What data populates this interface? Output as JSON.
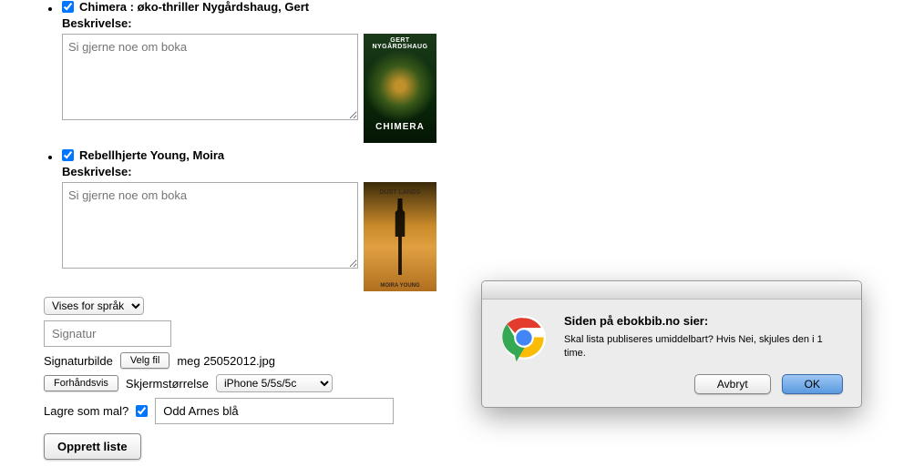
{
  "books": [
    {
      "checked": true,
      "title": "Chimera : øko-thriller Nygårdshaug, Gert",
      "desc_label": "Beskrivelse:",
      "placeholder": "Si gjerne noe om boka",
      "cover_author": "GERT NYGÅRDSHAUG",
      "cover_title": "CHIMERA"
    },
    {
      "checked": true,
      "title": "Rebellhjerte Young, Moira",
      "desc_label": "Beskrivelse:",
      "placeholder": "Si gjerne noe om boka",
      "cover_top": "DUST LANDS",
      "cover_bottom": "MOIRA YOUNG"
    }
  ],
  "form": {
    "lang_select": "Vises for språk",
    "signatur_placeholder": "Signatur",
    "sigbilde_label": "Signaturbilde",
    "velgfil": "Velg fil",
    "filename": "meg 25052012.jpg",
    "forhandsvis": "Forhåndsvis",
    "skjerm_label": "Skjermstørrelse",
    "skjerm_value": "iPhone 5/5s/5c",
    "mal_label": "Lagre som mal?",
    "mal_value": "Odd Arnes blå",
    "mal_checked": true,
    "opprett": "Opprett liste"
  },
  "dialog": {
    "title": "Siden på ebokbib.no sier:",
    "message": "Skal lista publiseres umiddelbart? Hvis Nei, skjules den i 1 time.",
    "cancel": "Avbryt",
    "ok": "OK"
  }
}
